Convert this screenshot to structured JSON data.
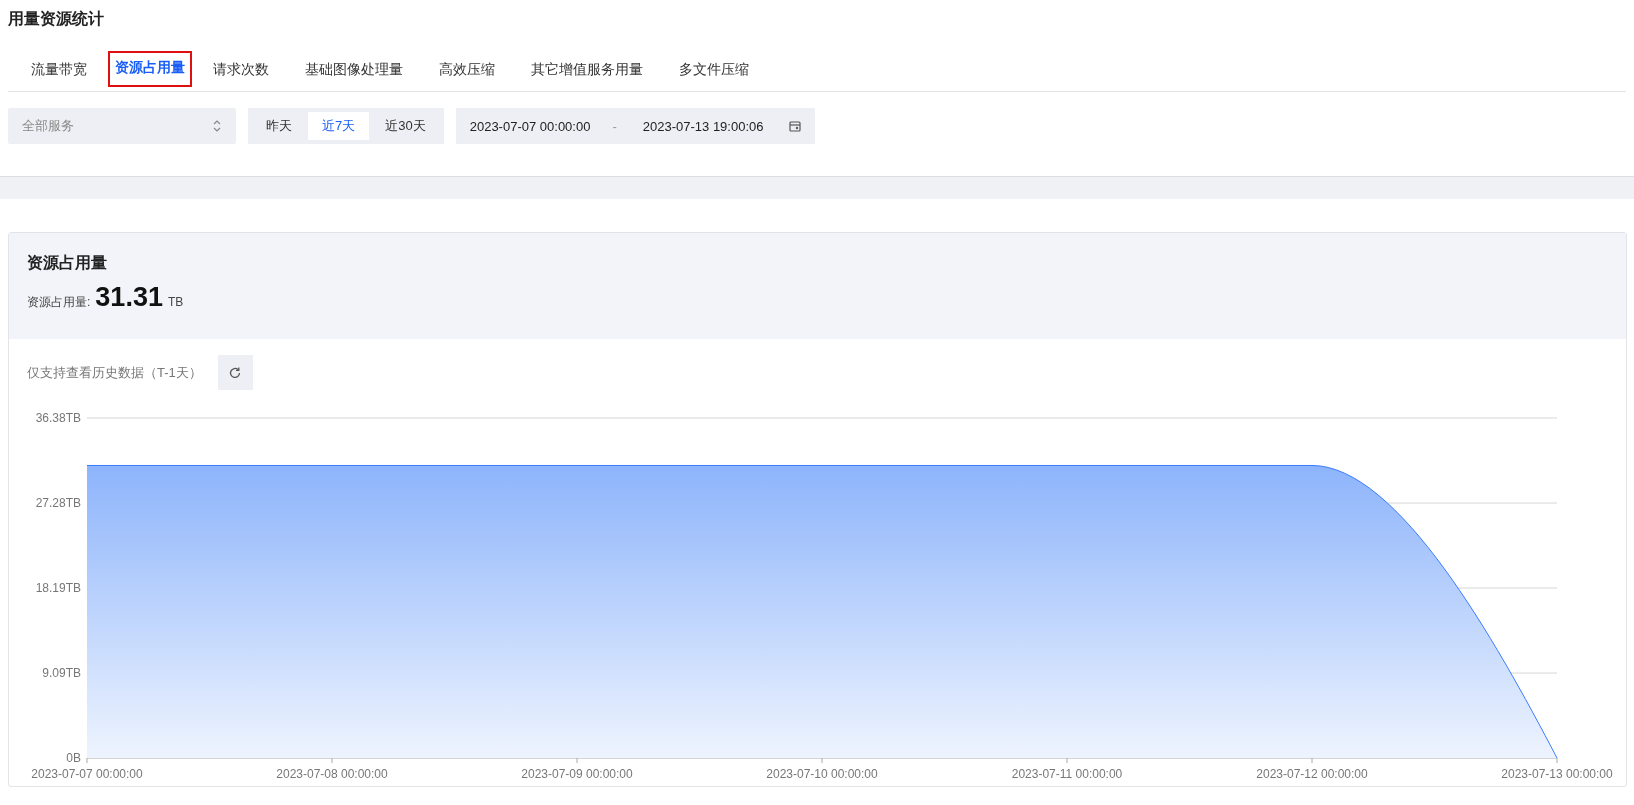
{
  "page_title": "用量资源统计",
  "tabs": [
    {
      "label": "流量带宽",
      "selected": false
    },
    {
      "label": "资源占用量",
      "selected": true
    },
    {
      "label": "请求次数",
      "selected": false
    },
    {
      "label": "基础图像处理量",
      "selected": false
    },
    {
      "label": "高效压缩",
      "selected": false
    },
    {
      "label": "其它增值服务用量",
      "selected": false
    },
    {
      "label": "多文件压缩",
      "selected": false
    }
  ],
  "service_select": {
    "value": "全部服务"
  },
  "quick_ranges": [
    {
      "label": "昨天",
      "selected": false
    },
    {
      "label": "近7天",
      "selected": true
    },
    {
      "label": "近30天",
      "selected": false
    }
  ],
  "date_range": {
    "start": "2023-07-07 00:00:00",
    "separator": "-",
    "end": "2023-07-13 19:00:06"
  },
  "card": {
    "title": "资源占用量",
    "metric_label": "资源占用量:",
    "metric_value": "31.31",
    "metric_unit": "TB",
    "note": "仅支持查看历史数据（T-1天）",
    "chart_data": {
      "type": "area",
      "categories": [
        "2023-07-07 00:00:00",
        "2023-07-08 00:00:00",
        "2023-07-09 00:00:00",
        "2023-07-10 00:00:00",
        "2023-07-11 00:00:00",
        "2023-07-12 00:00:00",
        "2023-07-13 00:00:00"
      ],
      "series": [
        {
          "color": "#3b7cff",
          "values": [
            31.3,
            31.3,
            31.3,
            31.3,
            31.3,
            31.3,
            0
          ]
        }
      ],
      "grid": true,
      "ylim": [
        0,
        36.38
      ],
      "yticks": [
        {
          "value": 0,
          "label": "0B"
        },
        {
          "value": 9.09,
          "label": "9.09TB"
        },
        {
          "value": 18.19,
          "label": "18.19TB"
        },
        {
          "value": 27.28,
          "label": "27.28TB"
        },
        {
          "value": 36.38,
          "label": "36.38TB"
        }
      ]
    }
  }
}
